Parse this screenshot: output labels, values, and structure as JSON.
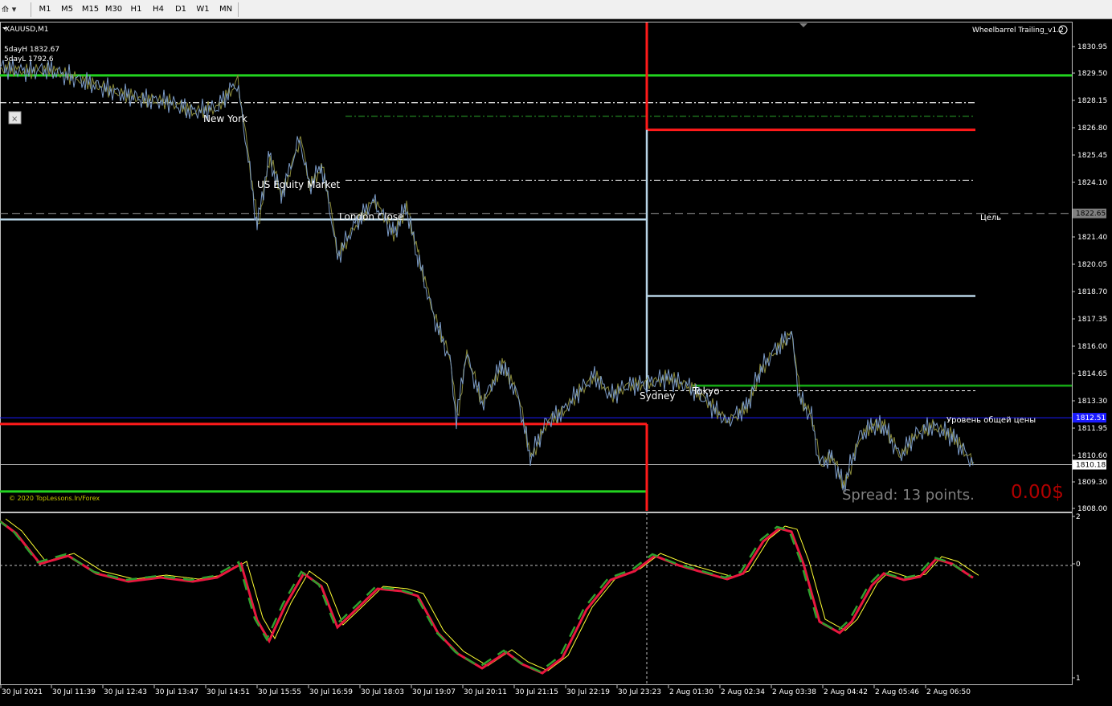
{
  "toolbar": {
    "timeframes": [
      "M1",
      "M5",
      "M15",
      "M30",
      "H1",
      "H4",
      "D1",
      "W1",
      "MN"
    ]
  },
  "chart": {
    "symbol_label": "XAUUSD,M1",
    "indicator_title": "Wheelbarrel Trailing_v1.2",
    "five_day_high": "5dayH 1832.67",
    "five_day_low": "5dayL 1792.6",
    "sessions": {
      "new_york": "New York",
      "us_equity": "US Equity Market",
      "london_close": "London Close",
      "sydney": "Sydney",
      "tokyo": "Tokyo"
    },
    "target_label": "Цель",
    "breakeven_label": "Уровень общей цены",
    "spread_text": "Spread: 13 points.",
    "profit_text": "0.00$",
    "copyright": "© 2020 TopLessons.In/Forex",
    "price_axis": [
      "1830.95",
      "1829.50",
      "1828.15",
      "1826.80",
      "1825.45",
      "1824.10",
      "1821.40",
      "1820.05",
      "1818.70",
      "1817.35",
      "1816.00",
      "1814.65",
      "1813.30",
      "1811.95",
      "1810.60",
      "1809.30",
      "1808.00"
    ],
    "price_tags": {
      "target_price": "1822.65",
      "breakeven_price": "1812.51",
      "current_price": "1810.18"
    },
    "osc_axis": [
      "2",
      "0",
      "1"
    ],
    "time_axis": [
      "30 Jul 2021",
      "30 Jul 11:39",
      "30 Jul 12:43",
      "30 Jul 13:47",
      "30 Jul 14:51",
      "30 Jul 15:55",
      "30 Jul 16:59",
      "30 Jul 18:03",
      "30 Jul 19:07",
      "30 Jul 20:11",
      "30 Jul 21:15",
      "30 Jul 22:19",
      "30 Jul 23:23",
      "2 Aug 01:30",
      "2 Aug 02:34",
      "2 Aug 03:38",
      "2 Aug 04:42",
      "2 Aug 05:46",
      "2 Aug 06:50"
    ]
  },
  "colors": {
    "background": "#000000",
    "price_line": "#7b9bc7",
    "price_line_alt": "#8a8a3a",
    "green_level": "#22d41f",
    "red_level": "#ff1a1a",
    "light_blue_level": "#b8d4e6",
    "breakeven_line": "#1a1aff",
    "spread_text": "#7f7f7f",
    "profit_text": "#b00000",
    "axis_text": "#ffffff",
    "osc_red": "#e8173f",
    "osc_green": "#2ea02e",
    "osc_yellow": "#ffff33"
  }
}
